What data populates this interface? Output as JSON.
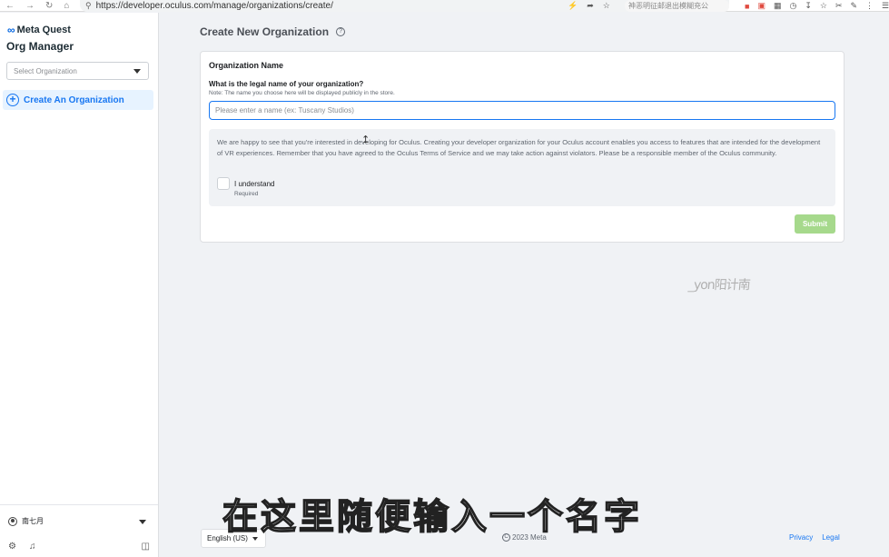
{
  "browser": {
    "url": "https://developer.oculus.com/manage/organizations/create/",
    "extension_text": "神恶明征邮退出模糊充公"
  },
  "sidebar": {
    "brand": "Meta Quest",
    "title": "Org Manager",
    "org_select_placeholder": "Select Organization",
    "create_label": "Create An Organization",
    "user_name": "南七月"
  },
  "main": {
    "page_title": "Create New Organization",
    "section_title": "Organization Name",
    "question": "What is the legal name of your organization?",
    "note": "Note: The name you choose here will be displayed publicly in the store.",
    "name_placeholder": "Please enter a name (ex: Tuscany Studios)",
    "name_value": "",
    "notice_text": "We are happy to see that you're interested in developing for Oculus. Creating your developer organization for your Oculus account enables you access to features that are intended for the development of VR experiences. Remember that you have agreed to the Oculus Terms of Service and we may take action against violators. Please be a responsible member of the Oculus community.",
    "checkbox_label": "I understand",
    "checkbox_required": "Required",
    "checkbox_checked": false,
    "submit_label": "Submit"
  },
  "watermark": "_yon阳计南",
  "footer": {
    "language": "English (US)",
    "copyright": "2023 Meta",
    "privacy": "Privacy",
    "legal": "Legal"
  },
  "video_subtitle": "在这里随便输入一个名字",
  "colors": {
    "accent": "#1877f2",
    "submit_disabled": "#a6d98c",
    "background": "#f0f2f5"
  }
}
